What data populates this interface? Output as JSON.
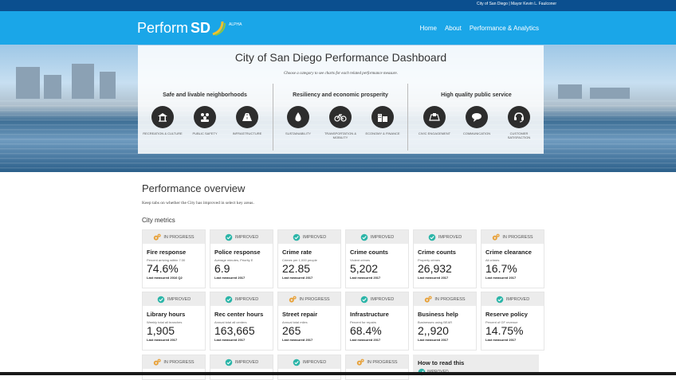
{
  "topbar": {
    "links": "City of San Diego  |  Mayor Kevin L. Faulconer"
  },
  "brand": {
    "name": "Perform",
    "sd": "SD",
    "badge": "ALPHA"
  },
  "nav": {
    "items": [
      "Home",
      "About",
      "Performance & Analytics"
    ]
  },
  "hero": {
    "title": "City of San Diego Performance Dashboard",
    "subtitle": "Choose a category to see charts for each related performance measure.",
    "categories": [
      {
        "title": "Safe and livable neighborhoods",
        "items": [
          {
            "label": "RECREATION & CULTURE",
            "icon": "gazebo-icon"
          },
          {
            "label": "PUBLIC SAFETY",
            "icon": "people-group-icon"
          },
          {
            "label": "INFRASTRUCTURE",
            "icon": "road-icon"
          }
        ]
      },
      {
        "title": "Resiliency and economic prosperity",
        "items": [
          {
            "label": "SUSTAINABILITY",
            "icon": "water-drop-icon"
          },
          {
            "label": "TRANSPORTATION & MOBILITY",
            "icon": "bicycle-icon"
          },
          {
            "label": "ECONOMY & FINANCE",
            "icon": "buildings-icon"
          }
        ]
      },
      {
        "title": "High quality public service",
        "items": [
          {
            "label": "CIVIC ENGAGEMENT",
            "icon": "ballot-icon"
          },
          {
            "label": "COMMUNICATION",
            "icon": "speech-bubble-icon"
          },
          {
            "label": "CUSTOMER SATISFACTION",
            "icon": "headset-icon"
          }
        ]
      }
    ]
  },
  "overview": {
    "title": "Performance overview",
    "subtitle": "Keep tabs on whether the City has improved in select key areas.",
    "metrics_title": "City metrics"
  },
  "status_labels": {
    "in_progress": "IN PROGRESS",
    "improved": "IMPROVED"
  },
  "colors": {
    "topbar": "#0b4f8f",
    "navbar": "#1aa6e8",
    "improved": "#2bb5a8",
    "in_progress": "#e8a23a"
  },
  "metrics": [
    {
      "status": "IN PROGRESS",
      "title": "Fire response",
      "desc": "Percent arriving within 7:30",
      "value": "74.6%",
      "measured": "Last measured 2016 Q2"
    },
    {
      "status": "IMPROVED",
      "title": "Police response",
      "desc": "Average minutes, Priority E",
      "value": "6.9",
      "measured": "Last measured 2017"
    },
    {
      "status": "IMPROVED",
      "title": "Crime rate",
      "desc": "Crimes per 1,000 people",
      "value": "22.85",
      "measured": "Last measured 2017"
    },
    {
      "status": "IMPROVED",
      "title": "Crime counts",
      "desc": "Violent crimes",
      "value": "5,202",
      "measured": "Last measured 2017"
    },
    {
      "status": "IMPROVED",
      "title": "Crime counts",
      "desc": "Property crimes",
      "value": "26,932",
      "measured": "Last measured 2017"
    },
    {
      "status": "IN PROGRESS",
      "title": "Crime clearance",
      "desc": "All crimes",
      "value": "16.7%",
      "measured": "Last measured 2017"
    },
    {
      "status": "IMPROVED",
      "title": "Library hours",
      "desc": "Weekly total all branches",
      "value": "1,905",
      "measured": "Last measured 2017"
    },
    {
      "status": "IMPROVED",
      "title": "Rec center hours",
      "desc": "Annual total all centers",
      "value": "163,665",
      "measured": "Last measured 2017"
    },
    {
      "status": "IN PROGRESS",
      "title": "Street repair",
      "desc": "Annual total miles",
      "value": "265",
      "measured": "Last measured 2017"
    },
    {
      "status": "IMPROVED",
      "title": "Infrastructure",
      "desc": "Percent for repairs",
      "value": "68.4%",
      "measured": "Last measured 2017"
    },
    {
      "status": "IN PROGRESS",
      "title": "Business help",
      "desc": "Businesses using BEAR",
      "value": "2,,920",
      "measured": "Last measured 2017"
    },
    {
      "status": "IMPROVED",
      "title": "Reserve policy",
      "desc": "Percent of GF revenue",
      "value": "14.75%",
      "measured": "Last measured 2017"
    }
  ],
  "row3": [
    "IN PROGRESS",
    "IMPROVED",
    "IMPROVED",
    "IN PROGRESS"
  ],
  "help": {
    "title": "How to read this",
    "status": "IMPROVED"
  }
}
